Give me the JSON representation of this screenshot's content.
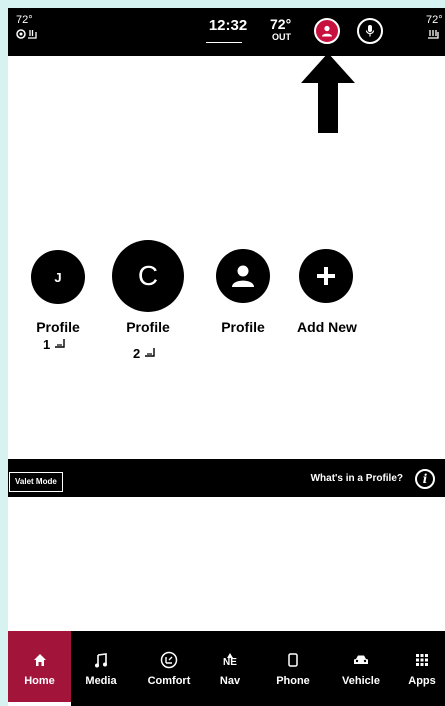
{
  "status_bar": {
    "left_temp": "72°",
    "left_seat_icons": "⛭⛆",
    "clock": "12:32",
    "outside_temp": "72°",
    "outside_label": "OUT",
    "right_temp": "72°",
    "right_seat_icons": "⛆"
  },
  "profiles": [
    {
      "initial": "J",
      "label": "Profile",
      "seat_number": "1"
    },
    {
      "initial": "C",
      "label": "Profile",
      "seat_number": "2"
    },
    {
      "icon": "person-icon",
      "label": "Profile"
    },
    {
      "icon": "plus-icon",
      "label": "Add New"
    }
  ],
  "valet": {
    "button_label": "Valet Mode",
    "help_text": "What's in a Profile?",
    "info_glyph": "i"
  },
  "nav": {
    "items": [
      {
        "label": "Home",
        "icon": "home-icon",
        "active": true
      },
      {
        "label": "Media",
        "icon": "music-note-icon"
      },
      {
        "label": "Comfort",
        "icon": "comfort-icon"
      },
      {
        "label": "Nav",
        "icon": "compass-icon",
        "compass": "NE"
      },
      {
        "label": "Phone",
        "icon": "phone-icon"
      },
      {
        "label": "Vehicle",
        "icon": "car-icon"
      },
      {
        "label": "Apps",
        "icon": "grid-icon"
      }
    ]
  },
  "colors": {
    "accent": "#c8103e",
    "nav_active": "#a3143a",
    "page_border": "#d6f3f2"
  }
}
